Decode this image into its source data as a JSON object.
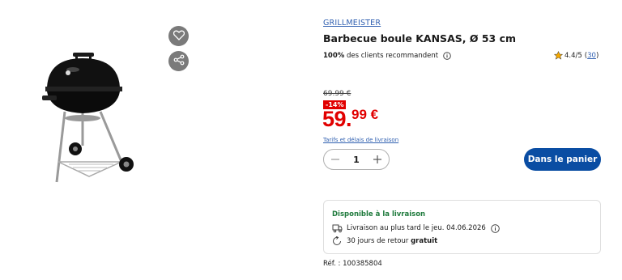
{
  "product": {
    "brand": "GRILLMEISTER",
    "title": "Barbecue boule KANSAS, Ø 53 cm",
    "recommend_pct": "100%",
    "recommend_text": " des clients recommandent",
    "rating": "4.4/5",
    "reviews": "30",
    "old_price": "69.99 €",
    "discount": "-14%",
    "price_main": "59.",
    "price_cents": "99 €",
    "shipping_link": "Tarifs et délais de livraison",
    "quantity": "1",
    "add_to_cart": "Dans le panier",
    "reference": "Réf. : 100385804"
  },
  "delivery": {
    "title": "Disponible à la livraison",
    "line1": "Livraison au plus tard le jeu. 04.06.2026",
    "return_prefix": "30 jours de retour ",
    "return_bold": "gratuit"
  },
  "icons": [
    "heart-icon",
    "share-icon",
    "info-icon",
    "star-icon",
    "minus-icon",
    "plus-icon",
    "truck-icon",
    "return-icon"
  ],
  "colors": {
    "brand_blue": "#0a4da3",
    "price_red": "#e10000",
    "available_green": "#1e7a3c"
  }
}
